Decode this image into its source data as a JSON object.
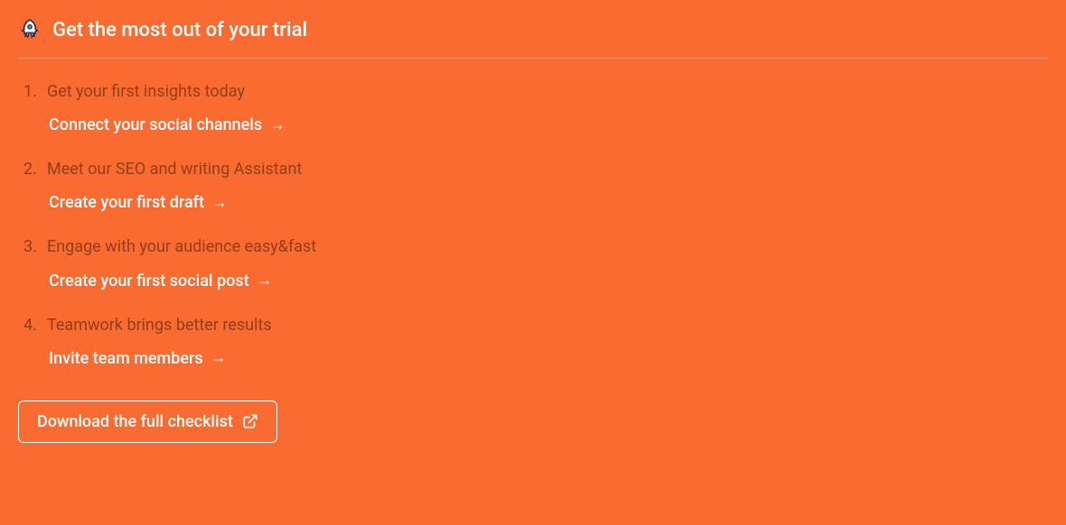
{
  "header": {
    "title": "Get the most out of your trial"
  },
  "steps": [
    {
      "description": "Get your first insights today",
      "action": "Connect your social channels"
    },
    {
      "description": "Meet our SEO and writing Assistant",
      "action": "Create your first draft"
    },
    {
      "description": "Engage with your audience easy&fast",
      "action": "Create your first social post"
    },
    {
      "description": "Teamwork brings better results",
      "action": "Invite team members"
    }
  ],
  "download": {
    "label": "Download the full checklist"
  }
}
